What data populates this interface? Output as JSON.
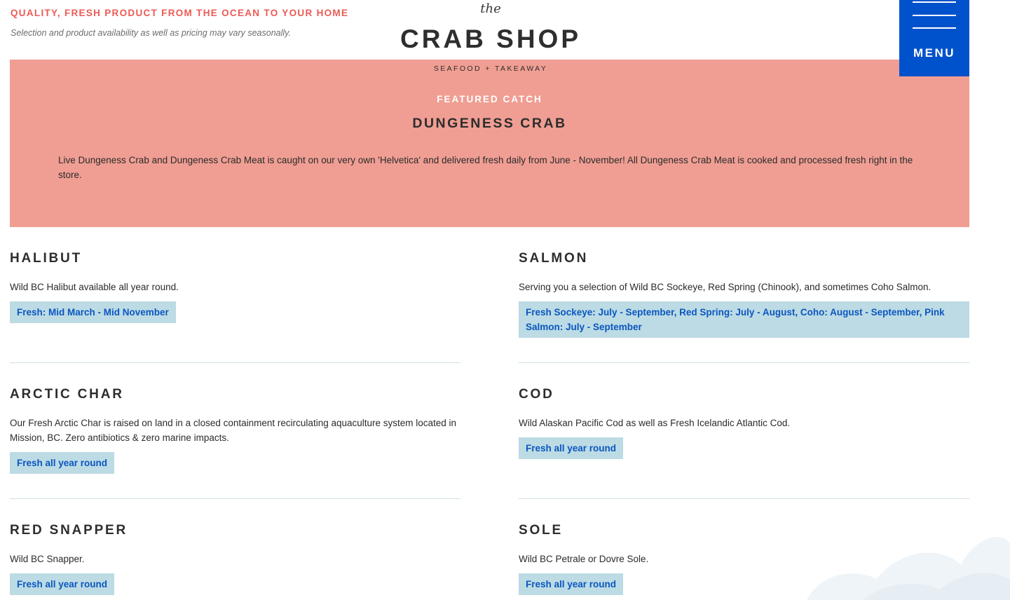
{
  "header": {
    "tagline": "QUALITY, FRESH PRODUCT FROM THE OCEAN TO YOUR HOME",
    "note": "Selection and product availability as well as pricing may vary seasonally."
  },
  "logo": {
    "the": "the",
    "main": "CRAB SHOP",
    "sub": "SEAFOOD + TAKEAWAY"
  },
  "menu": {
    "label": "MENU"
  },
  "featured": {
    "kicker": "FEATURED CATCH",
    "title": "DUNGENESS CRAB",
    "text": "Live Dungeness Crab and Dungeness Crab Meat is caught on our very own 'Helvetica' and delivered fresh daily from June - November! All Dungeness Crab Meat is cooked and processed fresh right in the store."
  },
  "items": [
    {
      "title": "HALIBUT",
      "desc": "Wild BC Halibut available all year round.",
      "season": "Fresh: Mid March - Mid November"
    },
    {
      "title": "SALMON",
      "desc": "Serving you a selection of Wild BC Sockeye, Red Spring (Chinook), and sometimes Coho Salmon.",
      "season": "Fresh Sockeye: July - September, Red Spring: July - August, Coho: August - September, Pink Salmon: July - September"
    },
    {
      "title": "ARCTIC CHAR",
      "desc": "Our Fresh Arctic Char is raised on land in a closed containment recirculating aquaculture system located in Mission, BC. Zero antibiotics & zero marine impacts.",
      "season": "Fresh all year round"
    },
    {
      "title": "COD",
      "desc": "Wild Alaskan Pacific Cod as well as Fresh Icelandic Atlantic Cod.",
      "season": "Fresh all year round"
    },
    {
      "title": "RED SNAPPER",
      "desc": "Wild BC Snapper.",
      "season": "Fresh all year round"
    },
    {
      "title": "SOLE",
      "desc": "Wild BC Petrale or Dovre Sole.",
      "season": "Fresh all year round"
    }
  ],
  "colors": {
    "accent_red": "#ec5a55",
    "featured_bg": "#f09e93",
    "menu_blue": "#0052cc",
    "badge_bg": "#bcdbe4",
    "badge_text": "#0b56c0"
  },
  "icons": {
    "menu": "hamburger-icon"
  }
}
